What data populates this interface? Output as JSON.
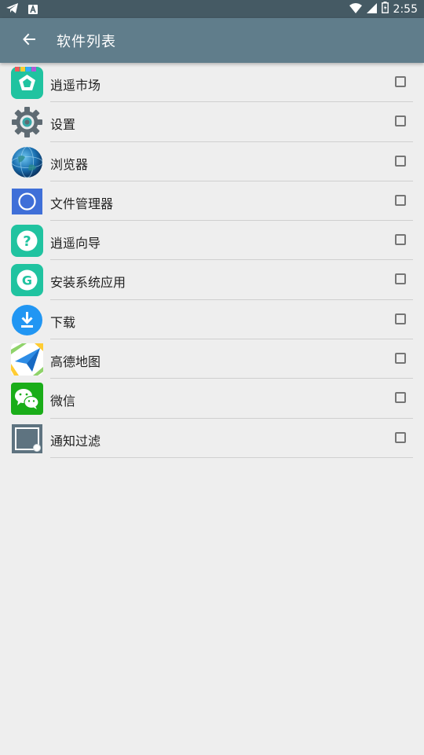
{
  "status_bar": {
    "time": "2:55"
  },
  "app_bar": {
    "title": "软件列表"
  },
  "apps": [
    {
      "name": "逍遥市场",
      "icon": "market-icon"
    },
    {
      "name": "设置",
      "icon": "settings-gear-icon"
    },
    {
      "name": "浏览器",
      "icon": "browser-globe-icon"
    },
    {
      "name": "文件管理器",
      "icon": "file-manager-icon"
    },
    {
      "name": "逍遥向导",
      "icon": "guide-question-icon"
    },
    {
      "name": "安装系统应用",
      "icon": "install-g-icon"
    },
    {
      "name": "下载",
      "icon": "download-icon"
    },
    {
      "name": "高德地图",
      "icon": "amap-icon"
    },
    {
      "name": "微信",
      "icon": "wechat-icon"
    },
    {
      "name": "通知过滤",
      "icon": "notification-filter-icon"
    }
  ],
  "colors": {
    "status_bar": "#455a64",
    "app_bar": "#607d8b",
    "background": "#eeeeee"
  }
}
